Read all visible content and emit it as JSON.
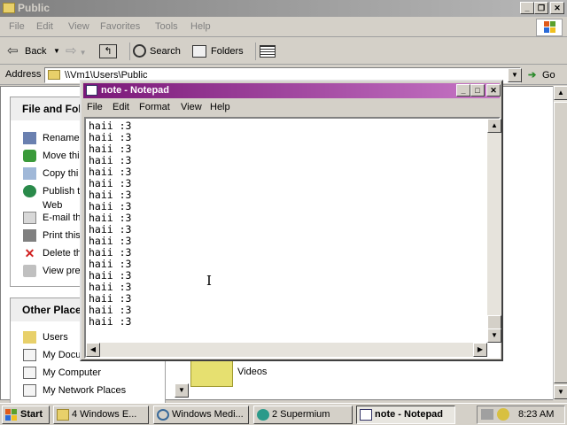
{
  "explorer": {
    "title": "Public",
    "menu": [
      "File",
      "Edit",
      "View",
      "Favorites",
      "Tools",
      "Help"
    ],
    "toolbar": {
      "back": "Back",
      "search": "Search",
      "folders": "Folders"
    },
    "address_label": "Address",
    "address_value": "\\\\Vm1\\Users\\Public",
    "go_label": "Go",
    "file_tasks": {
      "header": "File and Fol",
      "items": [
        "Rename",
        "Move thi",
        "Copy thi",
        "Publish t",
        "Web",
        "E-mail th",
        "Print this",
        "Delete th",
        "View pre"
      ]
    },
    "other_places": {
      "header": "Other Place",
      "items": [
        "Users",
        "My Docu",
        "My Computer",
        "My Network Places"
      ]
    },
    "folder_label": "Videos"
  },
  "notepad": {
    "title": "note - Notepad",
    "menu": [
      "File",
      "Edit",
      "Format",
      "View",
      "Help"
    ],
    "text": "haii :3\nhaii :3\nhaii :3\nhaii :3\nhaii :3\nhaii :3\nhaii :3\nhaii :3\nhaii :3\nhaii :3\nhaii :3\nhaii :3\nhaii :3\nhaii :3\nhaii :3\nhaii :3\nhaii :3\nhaii :3"
  },
  "taskbar": {
    "start": "Start",
    "buttons": [
      "4 Windows E...",
      "Windows Medi...",
      "2  Supermium",
      "note - Notepad"
    ],
    "clock": "8:23 AM"
  },
  "colors": {
    "notepad_title": "#7a1878",
    "inactive_title": "#808080",
    "xp_logo": "#e05a1a"
  }
}
